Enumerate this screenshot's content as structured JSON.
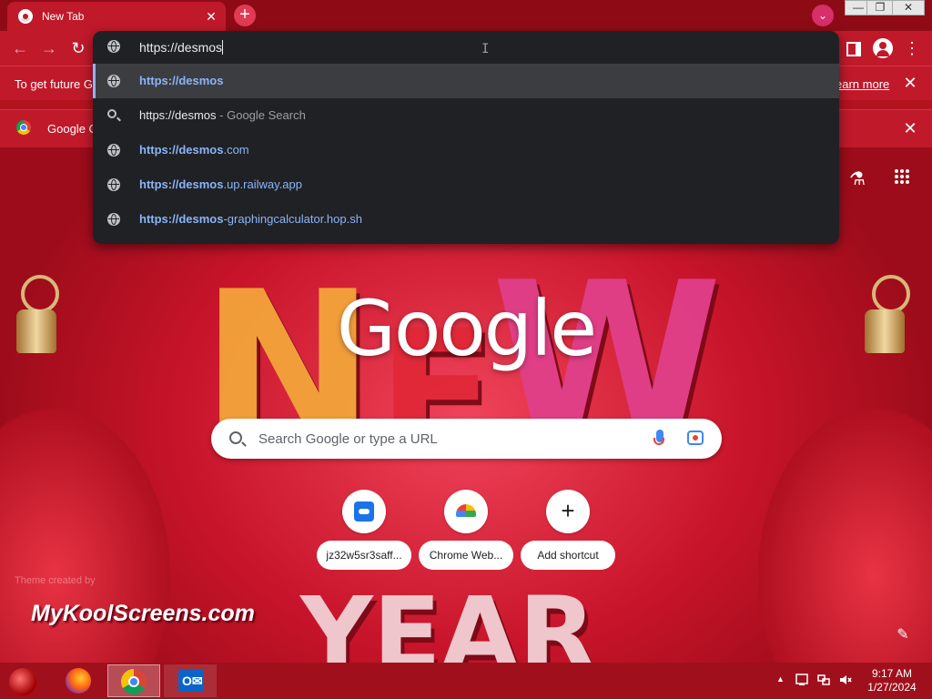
{
  "browser": {
    "tab": {
      "title": "New Tab",
      "close": "✕"
    },
    "new_tab": "+",
    "tab_search": "⌄",
    "window_controls": {
      "minimize": "—",
      "restore": "❐",
      "close": "✕"
    },
    "toolbar": {
      "back": "←",
      "forward": "→",
      "reload": "↻",
      "menu": "⋮"
    }
  },
  "infobars": [
    {
      "message": "To get future G",
      "link": "earn more",
      "close": "✕"
    },
    {
      "message": "Google C",
      "close": "✕"
    }
  ],
  "omnibox": {
    "value": "https://desmos",
    "suggestions": [
      {
        "icon": "globe-icon",
        "bold": "https://desmos",
        "rest": "",
        "suffix": "",
        "selected": true
      },
      {
        "icon": "search-icon",
        "bold": "",
        "rest": "https://desmos",
        "suffix": " - Google Search",
        "selected": false
      },
      {
        "icon": "globe-icon",
        "bold": "https://desmos",
        "rest": ".com",
        "suffix": "",
        "selected": false
      },
      {
        "icon": "globe-icon",
        "bold": "https://desmos",
        "rest": ".up.railway.app",
        "suffix": "",
        "selected": false
      },
      {
        "icon": "globe-icon",
        "bold": "https://desmos",
        "rest": "-graphingcalculator.hop.sh",
        "suffix": "",
        "selected": false
      }
    ]
  },
  "ntp": {
    "logo": "Google",
    "search_placeholder": "Search Google or type a URL",
    "shortcuts": [
      {
        "label": "jz32w5sr3saff...",
        "icon": "site-favicon"
      },
      {
        "label": "Chrome Web...",
        "icon": "chrome-web-store-icon"
      },
      {
        "label": "Add shortcut",
        "icon": "plus-icon"
      }
    ],
    "labs_icon": "⚗",
    "apps_icon": "⋮⋮⋮",
    "customize_icon": "✎",
    "theme_credit": "Theme created by"
  },
  "watermark": "MyKoolScreens.com",
  "taskbar": {
    "clock_time": "9:17 AM",
    "clock_date": "1/27/2024",
    "tray_arrow": "▲"
  },
  "colors": {
    "accent": "#c0192a",
    "dropdown_bg": "#202124",
    "suggestion_highlight": "#8ab4f8"
  }
}
